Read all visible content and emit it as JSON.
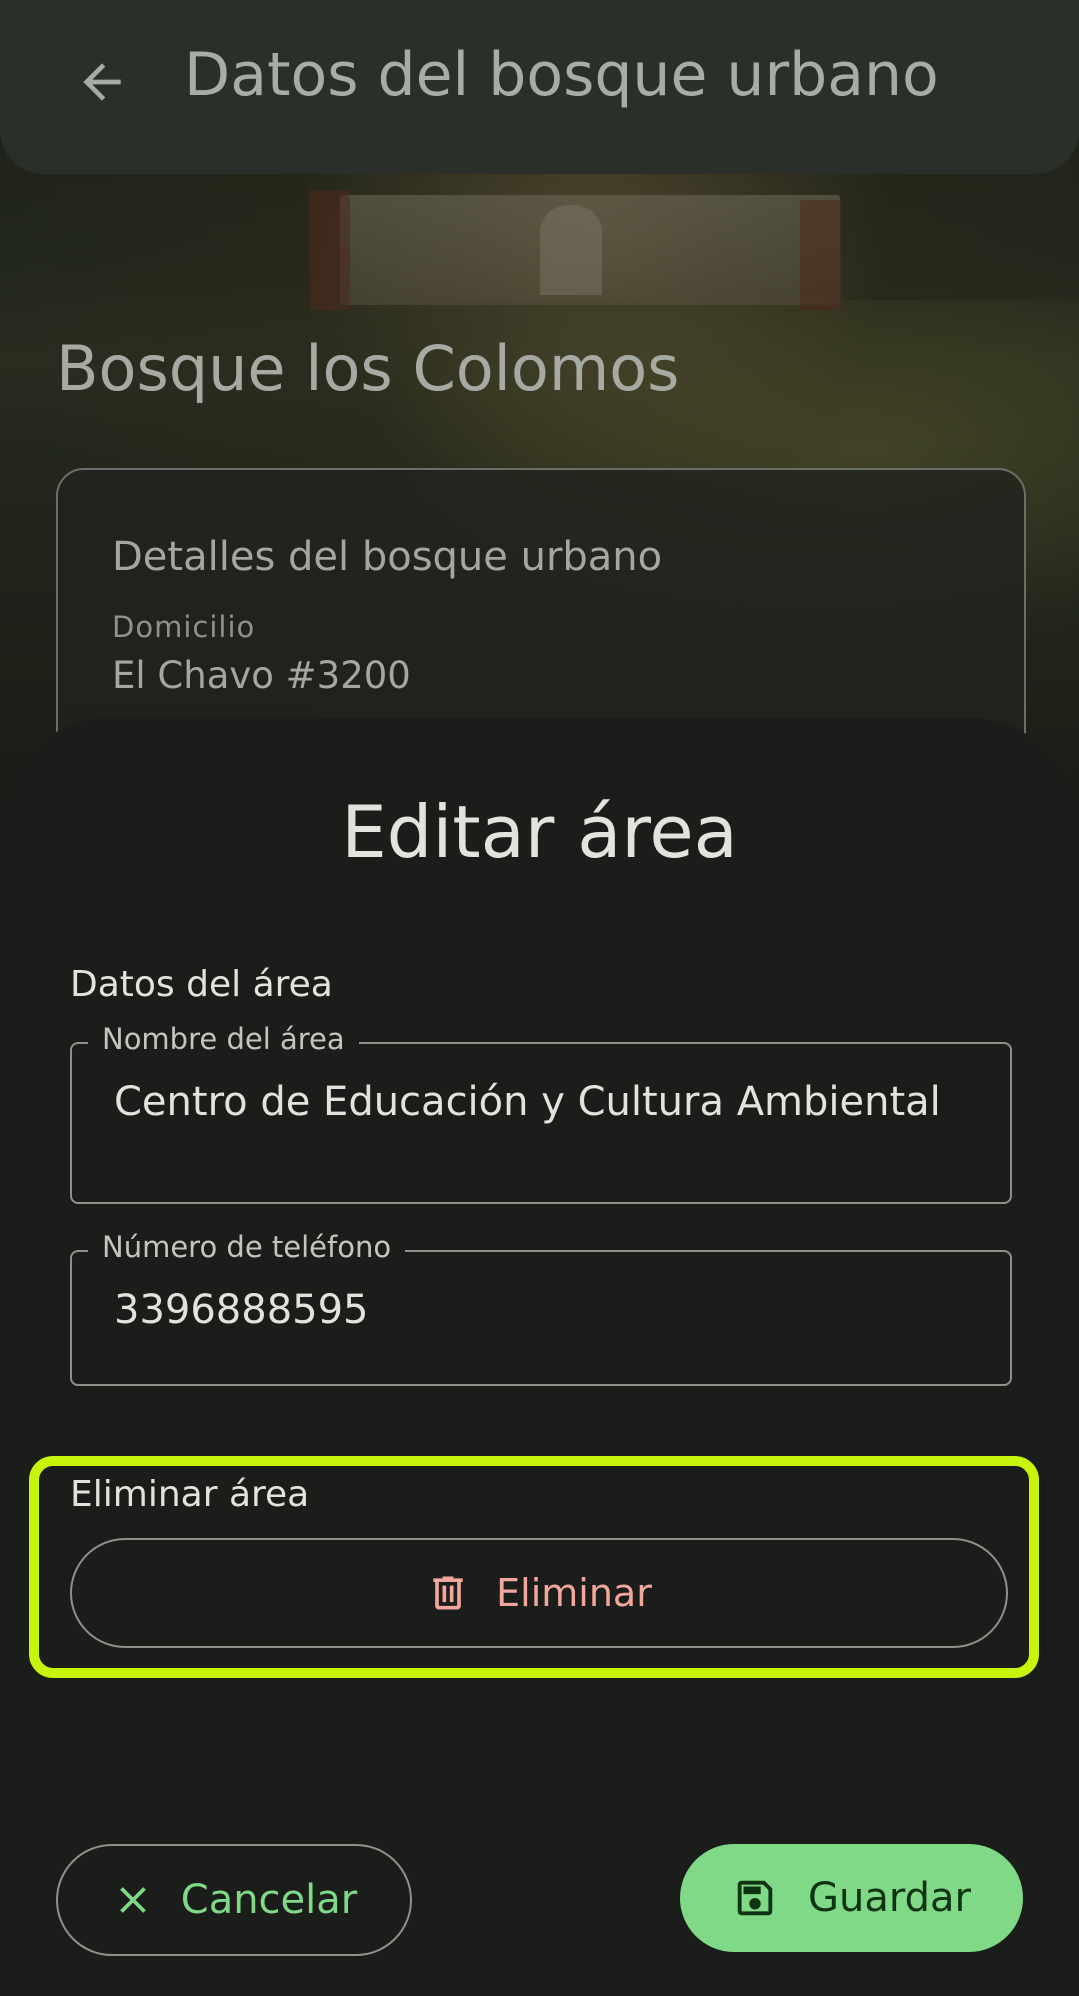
{
  "appbar": {
    "title": "Datos del bosque urbano",
    "back_icon": "arrow-left-icon"
  },
  "forest": {
    "name": "Bosque los Colomos"
  },
  "details_card": {
    "title": "Detalles del bosque urbano",
    "address_label": "Domicilio",
    "address_line1": "El Chavo #3200"
  },
  "sheet": {
    "title": "Editar área",
    "section_data_label": "Datos del área",
    "area_name": {
      "label": "Nombre del área",
      "value": "Centro de Educación y Cultura Ambiental"
    },
    "phone": {
      "label": "Número de teléfono",
      "value": "3396888595"
    },
    "delete_section": {
      "label": "Eliminar área",
      "button_label": "Eliminar",
      "icon": "trash-icon"
    },
    "cancel_button": {
      "label": "Cancelar",
      "icon": "close-icon"
    },
    "save_button": {
      "label": "Guardar",
      "icon": "save-icon"
    }
  },
  "colors": {
    "accent_green": "#7fd986",
    "delete_red": "#f2a79c",
    "highlight": "#c6f40a"
  }
}
